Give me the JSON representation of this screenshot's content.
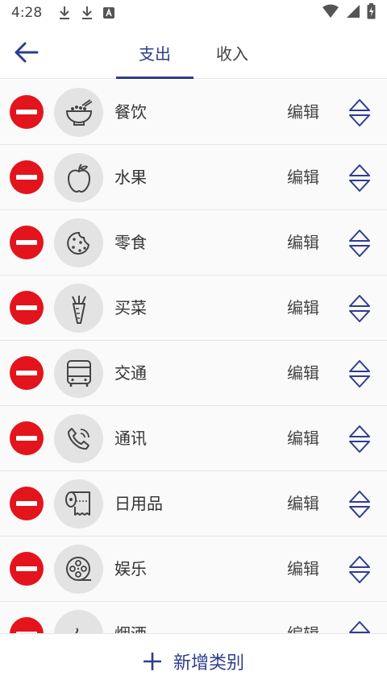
{
  "status_bar": {
    "time": "4:28"
  },
  "colors": {
    "accent": "#2f3d8c",
    "remove": "#e3141c",
    "icon_bg": "#e3e3e3"
  },
  "tabs": [
    {
      "label": "支出",
      "selected": true
    },
    {
      "label": "收入",
      "selected": false
    }
  ],
  "categories": [
    {
      "name": "餐饮",
      "icon": "rice-bowl-icon",
      "edit_label": "编辑"
    },
    {
      "name": "水果",
      "icon": "apple-icon",
      "edit_label": "编辑"
    },
    {
      "name": "零食",
      "icon": "cookie-icon",
      "edit_label": "编辑"
    },
    {
      "name": "买菜",
      "icon": "carrot-icon",
      "edit_label": "编辑"
    },
    {
      "name": "交通",
      "icon": "bus-icon",
      "edit_label": "编辑"
    },
    {
      "name": "通讯",
      "icon": "phone-icon",
      "edit_label": "编辑"
    },
    {
      "name": "日用品",
      "icon": "toilet-paper-icon",
      "edit_label": "编辑"
    },
    {
      "name": "娱乐",
      "icon": "film-reel-icon",
      "edit_label": "编辑"
    },
    {
      "name": "烟酒",
      "icon": "smoke-icon",
      "edit_label": "编辑"
    }
  ],
  "footer": {
    "add_label": "新增类别"
  }
}
